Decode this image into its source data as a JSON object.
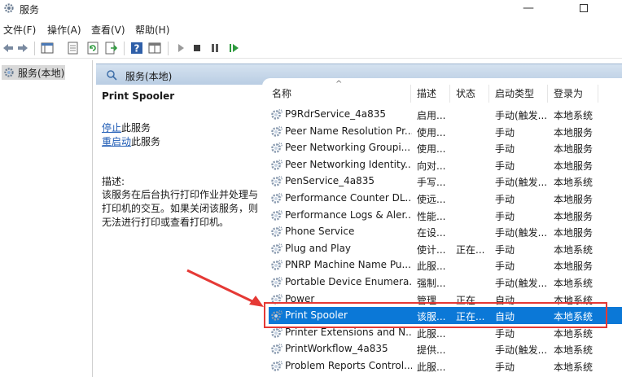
{
  "window": {
    "title": "服务",
    "minimize": "—"
  },
  "menu": [
    {
      "label": "文件(F)"
    },
    {
      "label": "操作(A)"
    },
    {
      "label": "查看(V)"
    },
    {
      "label": "帮助(H)"
    }
  ],
  "tree": {
    "root_label": "服务(本地)"
  },
  "main": {
    "header_label": "服务(本地)"
  },
  "details": {
    "title": "Print Spooler",
    "stop_link": "停止",
    "stop_suffix": "此服务",
    "restart_link": "重启动",
    "restart_suffix": "此服务",
    "desc_label": "描述:",
    "desc_text": "该服务在后台执行打印作业并处理与打印机的交互。如果关闭该服务，则无法进行打印或查看打印机。"
  },
  "columns": {
    "name": "名称",
    "desc": "描述",
    "status": "状态",
    "startup": "启动类型",
    "logon": "登录为",
    "sort_indicator": "^"
  },
  "rows": [
    {
      "name": "P9RdrService_4a835",
      "desc": "启用...",
      "status": "",
      "startup": "手动(触发...",
      "logon": "本地系统"
    },
    {
      "name": "Peer Name Resolution Pr...",
      "desc": "使用...",
      "status": "",
      "startup": "手动",
      "logon": "本地服务"
    },
    {
      "name": "Peer Networking Groupi...",
      "desc": "使用...",
      "status": "",
      "startup": "手动",
      "logon": "本地服务"
    },
    {
      "name": "Peer Networking Identity...",
      "desc": "向对...",
      "status": "",
      "startup": "手动",
      "logon": "本地服务"
    },
    {
      "name": "PenService_4a835",
      "desc": "手写...",
      "status": "",
      "startup": "手动(触发...",
      "logon": "本地系统"
    },
    {
      "name": "Performance Counter DL...",
      "desc": "使远...",
      "status": "",
      "startup": "手动",
      "logon": "本地服务"
    },
    {
      "name": "Performance Logs & Aler...",
      "desc": "性能...",
      "status": "",
      "startup": "手动",
      "logon": "本地服务"
    },
    {
      "name": "Phone Service",
      "desc": "在设...",
      "status": "",
      "startup": "手动(触发...",
      "logon": "本地服务"
    },
    {
      "name": "Plug and Play",
      "desc": "使计...",
      "status": "正在...",
      "startup": "手动",
      "logon": "本地系统"
    },
    {
      "name": "PNRP Machine Name Pu...",
      "desc": "此服...",
      "status": "",
      "startup": "手动",
      "logon": "本地服务"
    },
    {
      "name": "Portable Device Enumera...",
      "desc": "强制...",
      "status": "",
      "startup": "手动(触发...",
      "logon": "本地系统"
    },
    {
      "name": "Power",
      "desc": "管理...",
      "status": "正在...",
      "startup": "自动",
      "logon": "本地系统"
    },
    {
      "name": "Print Spooler",
      "desc": "该服...",
      "status": "正在...",
      "startup": "自动",
      "logon": "本地系统"
    },
    {
      "name": "Printer Extensions and N...",
      "desc": "此服...",
      "status": "",
      "startup": "手动",
      "logon": "本地系统"
    },
    {
      "name": "PrintWorkflow_4a835",
      "desc": "提供...",
      "status": "",
      "startup": "手动(触发...",
      "logon": "本地系统"
    },
    {
      "name": "Problem Reports Control...",
      "desc": "此服...",
      "status": "",
      "startup": "手动",
      "logon": "本地系统"
    }
  ],
  "selected_row": 12,
  "colors": {
    "selection": "#0b78d7",
    "annotation": "#e53935",
    "link": "#1e5bb5"
  },
  "icons": {
    "app": "gear-icon",
    "row": "service-gear-icon"
  }
}
